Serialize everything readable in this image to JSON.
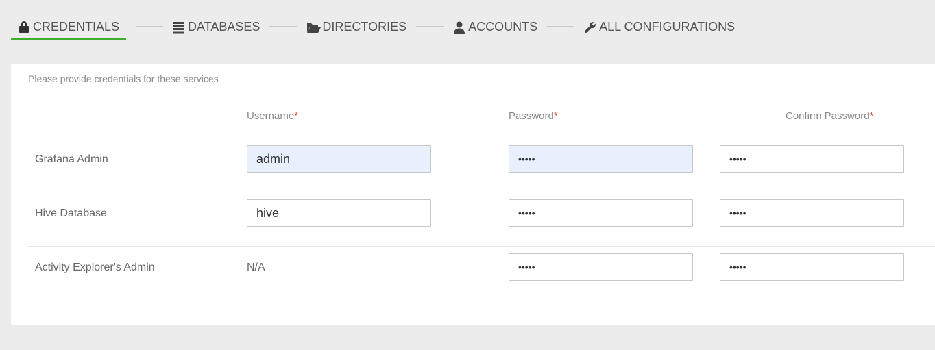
{
  "tabs": [
    {
      "label": "CREDENTIALS",
      "icon": "lock-icon",
      "active": true
    },
    {
      "label": "DATABASES",
      "icon": "database-icon",
      "active": false
    },
    {
      "label": "DIRECTORIES",
      "icon": "folder-open-icon",
      "active": false
    },
    {
      "label": "ACCOUNTS",
      "icon": "user-icon",
      "active": false
    },
    {
      "label": "ALL CONFIGURATIONS",
      "icon": "wrench-icon",
      "active": false
    }
  ],
  "accent_color": "#3fae2a",
  "required_color": "#e2403a",
  "panel": {
    "intro": "Please provide credentials for these services",
    "columns": {
      "username": "Username",
      "password": "Password",
      "confirm_password": "Confirm Password",
      "required_mark": "*"
    },
    "rows": [
      {
        "service": "Grafana Admin",
        "username": "admin",
        "username_na": null,
        "password": "•••••",
        "confirm": "•••••"
      },
      {
        "service": "Hive Database",
        "username": "hive",
        "username_na": null,
        "password": "•••••",
        "confirm": "•••••"
      },
      {
        "service": "Activity Explorer's Admin",
        "username": null,
        "username_na": "N/A",
        "password": "•••••",
        "confirm": "•••••"
      }
    ]
  }
}
